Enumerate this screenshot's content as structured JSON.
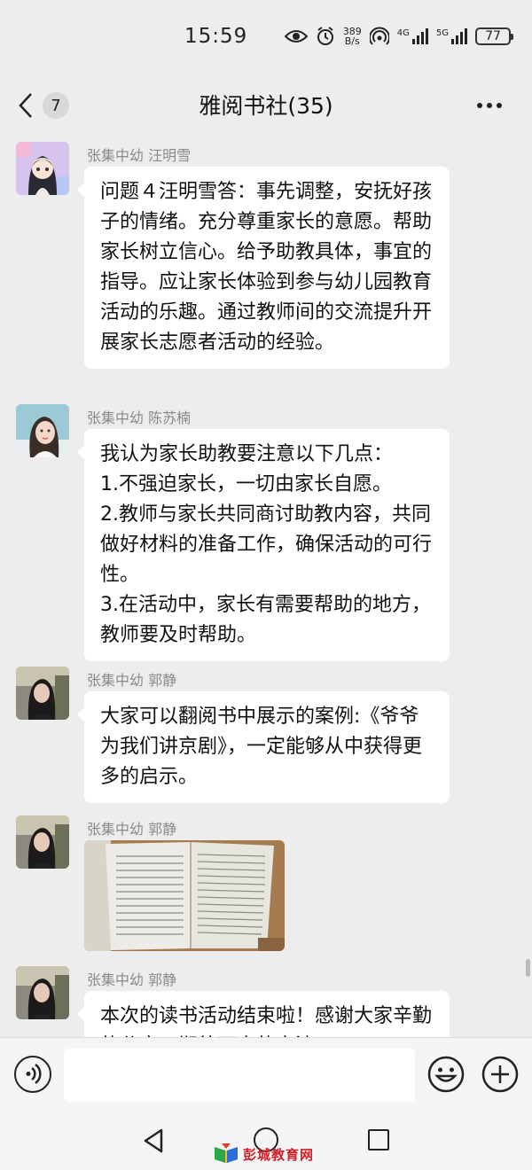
{
  "status_bar": {
    "time": "15:59",
    "net_speed_value": "389",
    "net_speed_unit": "B/s",
    "signal_1_label": "4G",
    "signal_2_label": "5G",
    "battery": "77"
  },
  "nav": {
    "unread_count": "7",
    "title": "雅阅书社(35)"
  },
  "messages": [
    {
      "sender": "张集中幼 汪明雪",
      "text": "问题４汪明雪答：事先调整，安抚好孩子的情绪。充分尊重家长的意愿。帮助家长树立信心。给予助教具体，事宜的指导。应让家长体验到参与幼儿园教育活动的乐趣。通过教师间的交流提升开展家长志愿者活动的经验。"
    },
    {
      "sender": "张集中幼 陈苏楠",
      "text": "我认为家长助教要注意以下几点：\n1.不强迫家长，一切由家长自愿。\n2.教师与家长共同商讨助教内容，共同做好材料的准备工作，确保活动的可行性。\n3.在活动中，家长有需要帮助的地方，教师要及时帮助。"
    },
    {
      "sender": "张集中幼 郭静",
      "text": "大家可以翻阅书中展示的案例:《爷爷为我们讲京剧》，一定能够从中获得更多的启示。"
    },
    {
      "sender": "张集中幼 郭静",
      "image": "book-photo"
    },
    {
      "sender": "张集中幼 郭静",
      "text": "本次的读书活动结束啦！感谢大家辛勤的分享，期待下次的交流。"
    }
  ],
  "watermark": {
    "text": "彭城教育网"
  },
  "icons": [
    "back-chevron-icon",
    "more-icon",
    "voice-icon",
    "emoji-icon",
    "plus-icon",
    "eye-icon",
    "alarm-icon",
    "hotspot-icon",
    "nav-back-icon",
    "nav-home-icon",
    "nav-recent-icon"
  ]
}
